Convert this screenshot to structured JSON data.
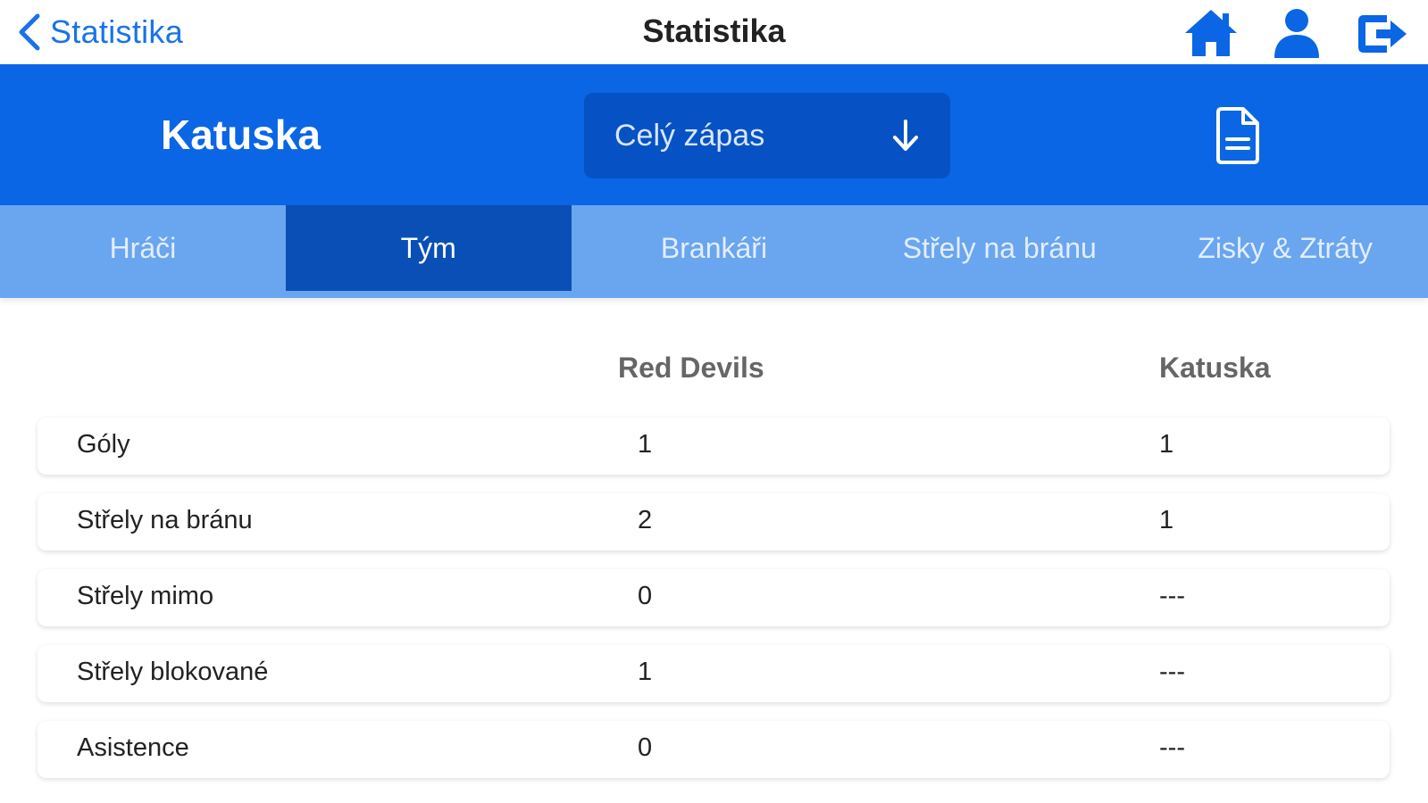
{
  "nav": {
    "back_label": "Statistika",
    "title": "Statistika",
    "icons": [
      "home-icon",
      "user-icon",
      "logout-icon"
    ]
  },
  "header": {
    "team": "Katuska",
    "period_select": "Celý zápas",
    "colors": {
      "band": "#0a66e4",
      "select_bg": "#0652c4",
      "tabs_bg": "#6aa6f0",
      "tab_active": "#0a4fb5",
      "link": "#1a73e8"
    }
  },
  "tabs": [
    {
      "label": "Hráči",
      "active": false
    },
    {
      "label": "Tým",
      "active": true
    },
    {
      "label": "Brankáři",
      "active": false
    },
    {
      "label": "Střely na bránu",
      "active": false
    },
    {
      "label": "Zisky & Ztráty",
      "active": false
    }
  ],
  "table": {
    "columns": [
      "Red Devils",
      "Katuska"
    ],
    "rows": [
      {
        "label": "Góly",
        "team1": "1",
        "team2": "1"
      },
      {
        "label": "Střely na bránu",
        "team1": "2",
        "team2": "1"
      },
      {
        "label": "Střely mimo",
        "team1": "0",
        "team2": "---"
      },
      {
        "label": "Střely blokované",
        "team1": "1",
        "team2": "---"
      },
      {
        "label": "Asistence",
        "team1": "0",
        "team2": "---"
      }
    ]
  }
}
